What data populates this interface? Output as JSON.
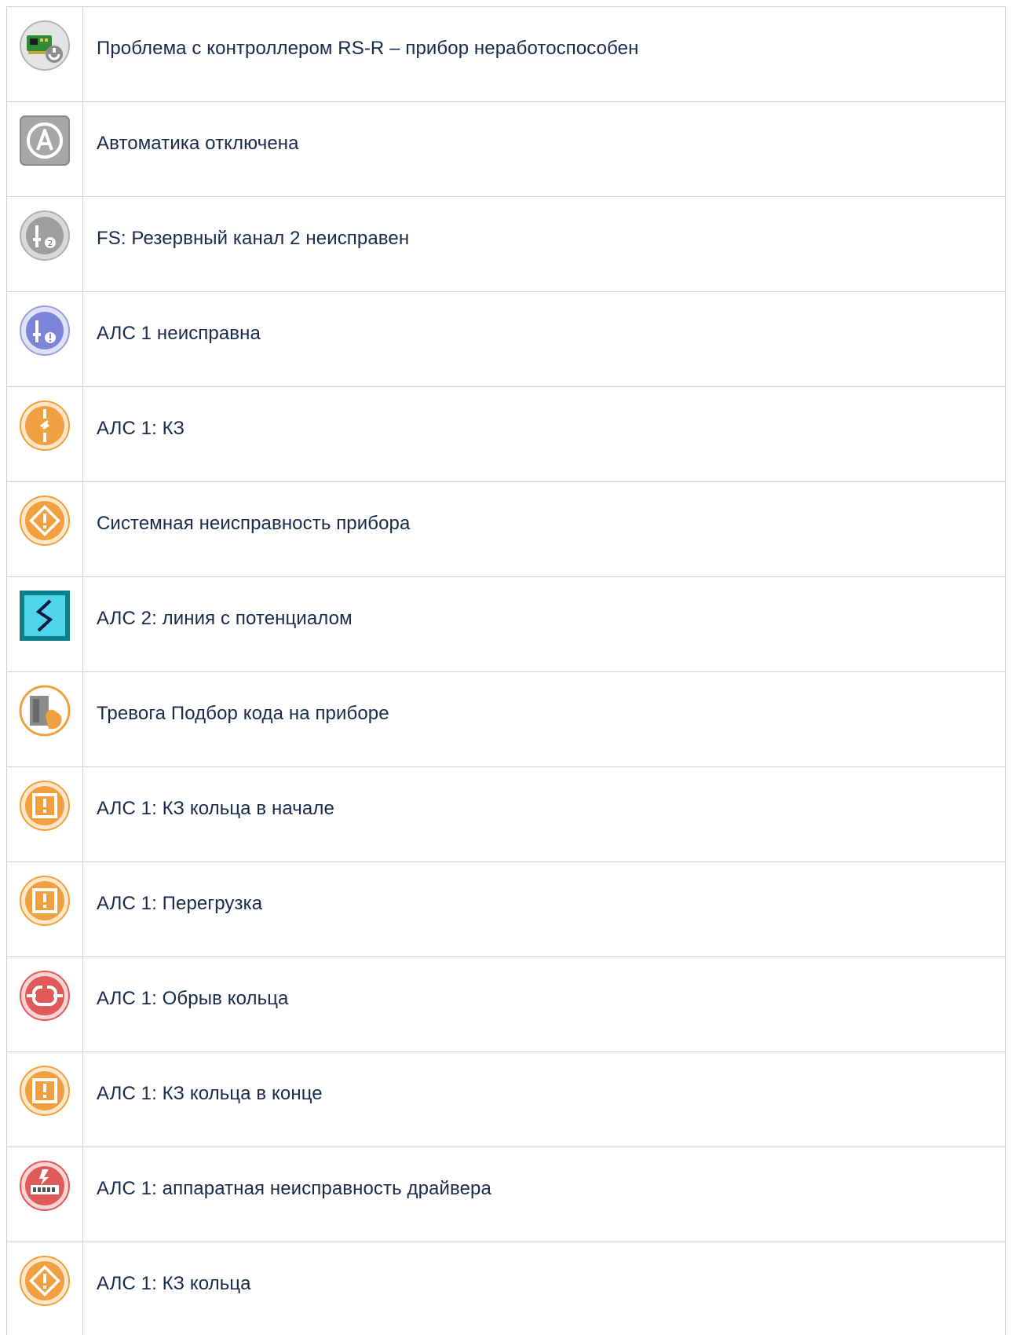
{
  "rows": [
    {
      "icon": "controller-card-wrench-icon",
      "text": "Проблема с контроллером RS-R – прибор неработоспособен"
    },
    {
      "icon": "automation-off-icon",
      "text": "Автоматика отключена"
    },
    {
      "icon": "reserve-channel-2-fault-icon",
      "text": "FS: Резервный канал 2 неисправен"
    },
    {
      "icon": "als-fault-icon",
      "text": "АЛС 1 неисправна"
    },
    {
      "icon": "short-circuit-icon",
      "text": "АЛС 1: КЗ"
    },
    {
      "icon": "diamond-warning-icon",
      "text": "Системная неисправность прибора"
    },
    {
      "icon": "line-potential-icon",
      "text": "АЛС 2: линия с потенциалом"
    },
    {
      "icon": "code-guessing-alarm-icon",
      "text": "Тревога Подбор кода на приборе"
    },
    {
      "icon": "ring-short-start-icon",
      "text": "АЛС 1: КЗ кольца в начале"
    },
    {
      "icon": "overload-icon",
      "text": "АЛС 1: Перегрузка"
    },
    {
      "icon": "ring-break-icon",
      "text": "АЛС 1: Обрыв кольца"
    },
    {
      "icon": "ring-short-end-icon",
      "text": "АЛС 1: КЗ кольца в конце"
    },
    {
      "icon": "driver-hardware-fault-icon",
      "text": "АЛС 1: аппаратная неисправность драйвера"
    },
    {
      "icon": "ring-short-icon",
      "text": "АЛС 1: КЗ кольца"
    }
  ],
  "colors": {
    "text": "#172b4d",
    "border": "#cfcfcf",
    "orange": "#f0a040",
    "red": "#e05a5a",
    "blue": "#7b84d8",
    "gray": "#9e9e9e",
    "teal": "#0e7f86"
  }
}
